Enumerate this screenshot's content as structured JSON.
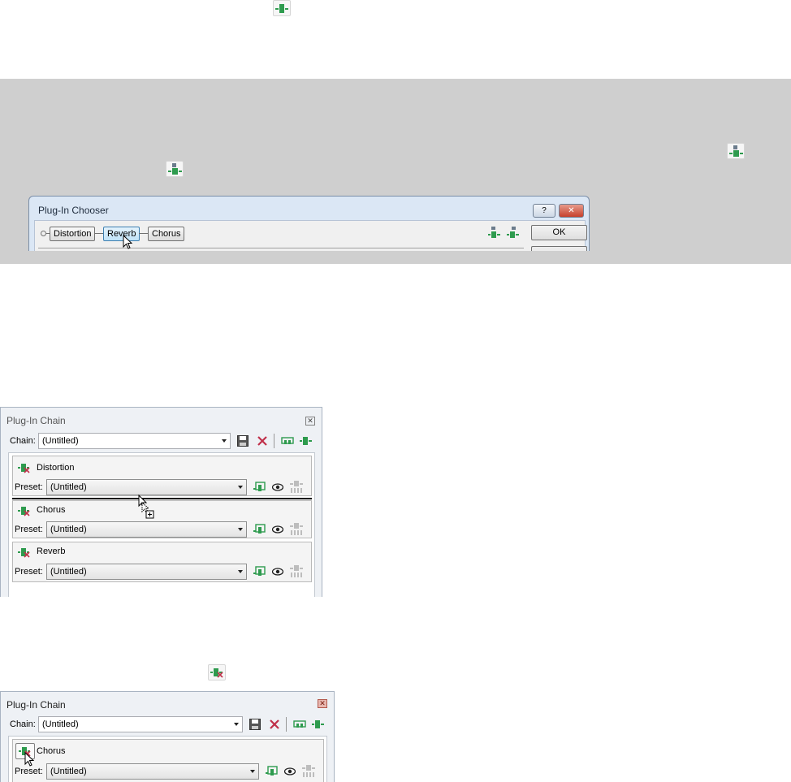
{
  "icons": {
    "top_insert": "insert-plugin-icon",
    "gray_right": "add-plugin-icon",
    "gray_left": "add-plugin-icon",
    "remove_icon": "remove-plugin-icon"
  },
  "colors": {
    "accent_green": "#2e9b4e",
    "remove_red": "#c0304a",
    "gray_band": "#cfcfcf"
  },
  "chooser": {
    "title": "Plug-In Chooser",
    "help_label": "?",
    "close_label": "✕",
    "plugins": [
      "Distortion",
      "Reverb",
      "Chorus"
    ],
    "selected": "Reverb",
    "ok_label": "OK"
  },
  "chain1": {
    "title": "Plug-In Chain",
    "chain_label": "Chain:",
    "chain_value": "(Untitled)",
    "slots": [
      {
        "name": "Distortion",
        "preset_label": "Preset:",
        "preset_value": "(Untitled)"
      },
      {
        "name": "Chorus",
        "preset_label": "Preset:",
        "preset_value": "(Untitled)"
      },
      {
        "name": "Reverb",
        "preset_label": "Preset:",
        "preset_value": "(Untitled)"
      }
    ]
  },
  "chain2": {
    "title": "Plug-In Chain",
    "chain_label": "Chain:",
    "chain_value": "(Untitled)",
    "slots": [
      {
        "name": "Chorus",
        "preset_label": "Preset:",
        "preset_value": "(Untitled)"
      }
    ]
  }
}
